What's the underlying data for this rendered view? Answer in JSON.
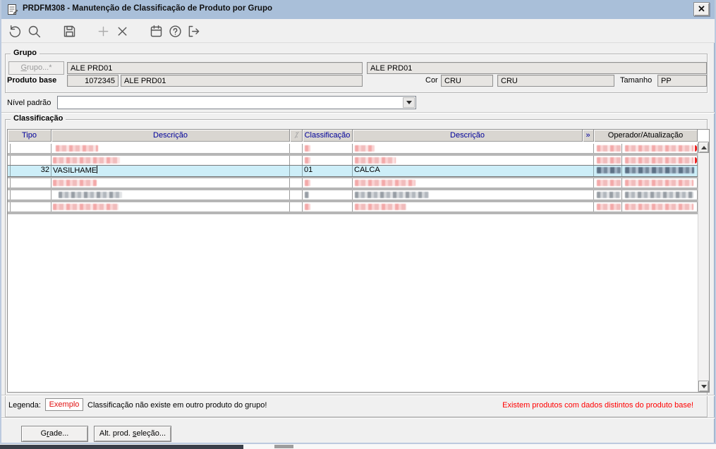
{
  "window": {
    "title": "PRDFM308 - Manutenção de Classificação de Produto por Grupo",
    "close_label": "X"
  },
  "toolbar": {
    "icons": [
      {
        "name": "undo",
        "enabled": true
      },
      {
        "name": "search",
        "enabled": true
      },
      {
        "name": "save",
        "enabled": true
      },
      {
        "name": "add",
        "enabled": false
      },
      {
        "name": "delete",
        "enabled": true
      },
      {
        "name": "calendar",
        "enabled": true
      },
      {
        "name": "help",
        "enabled": true
      },
      {
        "name": "exit",
        "enabled": true
      }
    ]
  },
  "grupo": {
    "legend": "Grupo",
    "grupo_button": {
      "label": "Grupo...*",
      "accel_index": 0
    },
    "grupo_value": "ALE PRD01",
    "grupo_value2": "ALE PRD01",
    "produto_base_label": "Produto base",
    "produto_base_code": "1072345",
    "produto_base_desc": "ALE PRD01",
    "cor_label": "Cor",
    "cor_code": "CRU",
    "cor_desc": "CRU",
    "tamanho_label": "Tamanho",
    "tamanho_value": "PP"
  },
  "nivel": {
    "label": "Nível padrão",
    "value": ""
  },
  "classificacao": {
    "legend": "Classificação",
    "headers": [
      {
        "label": "Tipo"
      },
      {
        "label": "Descrição"
      },
      {
        "label": "⁒",
        "muted": true
      },
      {
        "label": "Classificação"
      },
      {
        "label": "Descrição"
      },
      {
        "label": "»"
      },
      {
        "label": "Operador/Atualização",
        "black": true
      }
    ],
    "rows": [
      {
        "selected": false,
        "variant": "pink",
        "redact": {
          "desc1": [
            4,
            60
          ],
          "cls": [
            1,
            8
          ],
          "desc2": [
            1,
            28
          ],
          "op1": [
            2,
            34
          ],
          "op2": [
            2,
            97
          ]
        },
        "edge_mark": true
      },
      {
        "selected": false,
        "variant": "pink",
        "redact": {
          "desc1": [
            0,
            95
          ],
          "cls": [
            1,
            8
          ],
          "desc2": [
            1,
            58
          ],
          "op1": [
            2,
            34
          ],
          "op2": [
            2,
            97
          ]
        },
        "edge_mark": true
      },
      {
        "selected": true,
        "variant": "blue",
        "tipo": "32",
        "descricao": "VASILHAME",
        "classificacao": "01",
        "descricao2": "CALCA",
        "redact": {
          "op1": [
            2,
            34
          ],
          "op2": [
            2,
            98
          ]
        }
      },
      {
        "selected": false,
        "variant": "pink",
        "redact": {
          "desc1": [
            0,
            62
          ],
          "cls": [
            1,
            8
          ],
          "desc2": [
            1,
            86
          ],
          "op1": [
            2,
            34
          ],
          "op2": [
            2,
            97
          ]
        }
      },
      {
        "selected": false,
        "variant": "gray",
        "redact": {
          "desc1": [
            8,
            90
          ],
          "cls": [
            1,
            6
          ],
          "desc2": [
            1,
            105
          ],
          "op1": [
            2,
            34
          ],
          "op2": [
            2,
            97
          ]
        }
      },
      {
        "selected": false,
        "variant": "pink",
        "redact": {
          "desc1": [
            0,
            93
          ],
          "cls": [
            1,
            8
          ],
          "desc2": [
            1,
            73
          ],
          "op1": [
            2,
            34
          ],
          "op2": [
            2,
            97
          ]
        }
      }
    ]
  },
  "legenda": {
    "label": "Legenda:",
    "exemplo": "Exemplo",
    "text": "Classificação não existe em outro produto do grupo!",
    "warning": "Existem produtos com dados distintos do produto base!"
  },
  "footer": {
    "grade_button": {
      "label": "Grade...",
      "accel_index": 1
    },
    "alt_button": {
      "label": "Alt. prod. seleção...",
      "accel_index": 11
    }
  },
  "colors": {
    "titlebar": "#a9bfd9",
    "selected_row": "#cdeef8",
    "header_text": "#00009b",
    "warning_text": "#ff0000",
    "redact_pink": "#f3a9a9",
    "redact_gray": "#989ea5",
    "redact_blue": "#5d7186"
  }
}
